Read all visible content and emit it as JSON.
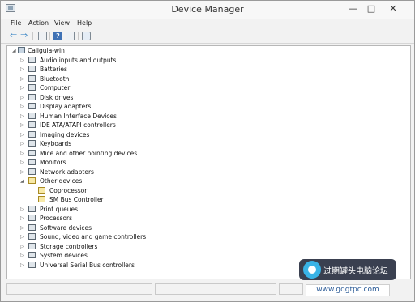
{
  "window": {
    "title": "Device Manager",
    "controls": {
      "minimize": "—",
      "maximize": "□",
      "close": "✕"
    }
  },
  "menu": {
    "items": [
      "File",
      "Action",
      "View",
      "Help"
    ]
  },
  "toolbar": {
    "buttons": [
      "back-icon",
      "forward-icon",
      "properties-icon",
      "help-icon",
      "pane-icon",
      "scan-hardware-icon"
    ]
  },
  "tree": {
    "root": {
      "label": "Caligula-win",
      "icon": "computer-icon",
      "expanded": true
    },
    "categories": [
      {
        "label": "Audio inputs and outputs",
        "icon": "speaker-icon",
        "expanded": false
      },
      {
        "label": "Batteries",
        "icon": "battery-icon",
        "expanded": false
      },
      {
        "label": "Bluetooth",
        "icon": "bluetooth-icon",
        "expanded": false
      },
      {
        "label": "Computer",
        "icon": "computer-icon",
        "expanded": false
      },
      {
        "label": "Disk drives",
        "icon": "disk-icon",
        "expanded": false
      },
      {
        "label": "Display adapters",
        "icon": "display-adapter-icon",
        "expanded": false
      },
      {
        "label": "Human Interface Devices",
        "icon": "hid-icon",
        "expanded": false
      },
      {
        "label": "IDE ATA/ATAPI controllers",
        "icon": "ide-icon",
        "expanded": false
      },
      {
        "label": "Imaging devices",
        "icon": "camera-icon",
        "expanded": false
      },
      {
        "label": "Keyboards",
        "icon": "keyboard-icon",
        "expanded": false
      },
      {
        "label": "Mice and other pointing devices",
        "icon": "mouse-icon",
        "expanded": false
      },
      {
        "label": "Monitors",
        "icon": "monitor-icon",
        "expanded": false
      },
      {
        "label": "Network adapters",
        "icon": "network-icon",
        "expanded": false
      },
      {
        "label": "Other devices",
        "icon": "unknown-device-icon",
        "expanded": true,
        "children": [
          {
            "label": "Coprocessor",
            "icon": "warning-device-icon"
          },
          {
            "label": "SM Bus Controller",
            "icon": "warning-device-icon"
          }
        ]
      },
      {
        "label": "Print queues",
        "icon": "printer-icon",
        "expanded": false
      },
      {
        "label": "Processors",
        "icon": "processor-icon",
        "expanded": false
      },
      {
        "label": "Software devices",
        "icon": "software-device-icon",
        "expanded": false
      },
      {
        "label": "Sound, video and game controllers",
        "icon": "sound-icon",
        "expanded": false
      },
      {
        "label": "Storage controllers",
        "icon": "storage-icon",
        "expanded": false
      },
      {
        "label": "System devices",
        "icon": "system-icon",
        "expanded": false
      },
      {
        "label": "Universal Serial Bus controllers",
        "icon": "usb-icon",
        "expanded": false
      }
    ]
  },
  "watermark": {
    "title": "过期罐头电脑论坛",
    "url": "www.gqgtpc.com"
  }
}
